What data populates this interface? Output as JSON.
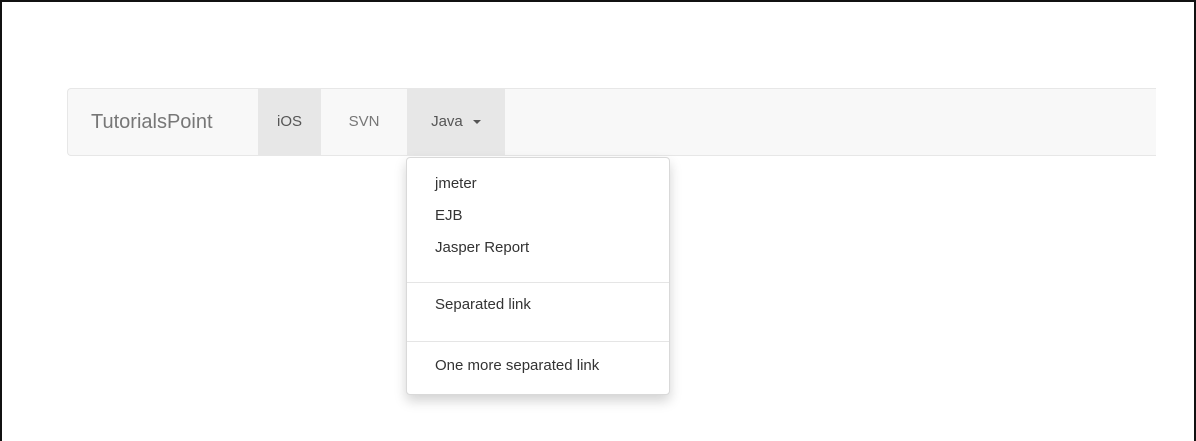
{
  "navbar": {
    "brand": "TutorialsPoint",
    "items": [
      {
        "label": "iOS",
        "active": true
      },
      {
        "label": "SVN",
        "active": false
      },
      {
        "label": "Java",
        "active": true,
        "dropdown": true
      }
    ]
  },
  "dropdown": {
    "items": [
      "jmeter",
      "EJB",
      "Jasper Report"
    ],
    "separated_link": "Separated link",
    "one_more_separated_link": "One more separated link"
  },
  "colors": {
    "navbar_bg": "#f8f8f8",
    "active_bg": "#e7e7e7",
    "text_muted": "#777777",
    "text_dark": "#333333"
  }
}
